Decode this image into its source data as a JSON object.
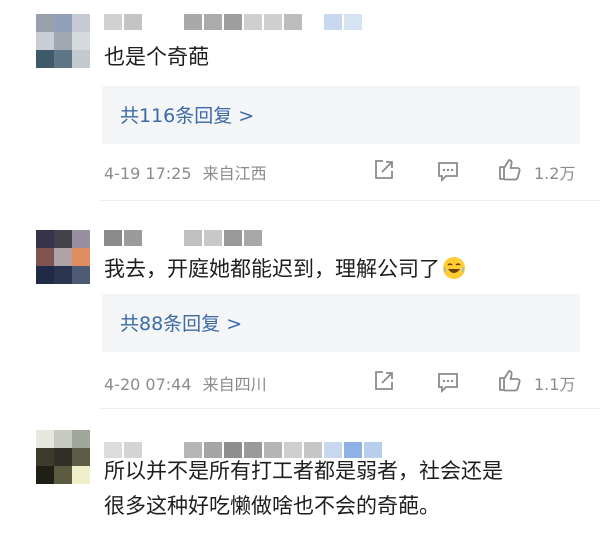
{
  "comments": [
    {
      "text": "也是个奇葩",
      "reply_label": "共116条回复 >",
      "date": "4-19 17:25",
      "location": "来自江西",
      "likes": "1.2万",
      "avatar_colors": [
        "#9aa0ab",
        "#8fa0b8",
        "#c4c9d4",
        "#c9cdd4",
        "#a2a8b2",
        "#d6d9de",
        "#3e5a6a",
        "#5f7686",
        "#c2c9cf"
      ],
      "username_colors": [
        "#d0d0d0",
        "#c4c4c4",
        "#ffffff",
        "#ffffff",
        "#a9a9a9",
        "#ababab",
        "#9e9e9e",
        "#cfcfcf",
        "#cfcfcf",
        "#bdbdbd",
        "#ffffff",
        "#c8d8ee",
        "#d6e3f3"
      ]
    },
    {
      "text": "我去，开庭她都能迟到，理解公司了",
      "reply_label": "共88条回复 >",
      "date": "4-20 07:44",
      "location": "来自四川",
      "likes": "1.1万",
      "avatar_colors": [
        "#38334a",
        "#42424a",
        "#9a8fa0",
        "#7f5450",
        "#b0a3a8",
        "#e08d5f",
        "#1e2a46",
        "#2b3550",
        "#4c5a74"
      ],
      "username_colors": [
        "#8b8b8b",
        "#9b9b9b",
        "#ffffff",
        "#ffffff",
        "#c0c0c0",
        "#c8c8c8",
        "#9a9a9a",
        "#a8a8a8"
      ]
    },
    {
      "text_line1": "所以并不是所有打工者都是弱者，社会还是",
      "text_line2": "很多这种好吃懒做啥也不会的奇葩。",
      "avatar_colors": [
        "#e6e8e0",
        "#c6cac0",
        "#9ea79a",
        "#3c3b2c",
        "#2f2f26",
        "#5d5c46",
        "#1f1f16",
        "#5a5a40",
        "#f0eec8"
      ],
      "username_colors": [
        "#dcdcdc",
        "#d4d4d4",
        "#ffffff",
        "#ffffff",
        "#b6b6b6",
        "#a5a5a5",
        "#8e8e8e",
        "#9a9a9a",
        "#b5b5b5",
        "#cfcfcf",
        "#c6c6c6",
        "#c7d7ee",
        "#8fb1e6",
        "#b9cdee"
      ]
    }
  ],
  "icons": {
    "share": "share-icon",
    "comment": "comment-icon",
    "like": "thumbs-up-icon",
    "emoji": "laughing-crying-emoji-icon"
  },
  "colors": {
    "reply_link": "#3b6aa6",
    "meta_text": "#8b8b8b",
    "reply_bg": "#f4f5f7"
  }
}
